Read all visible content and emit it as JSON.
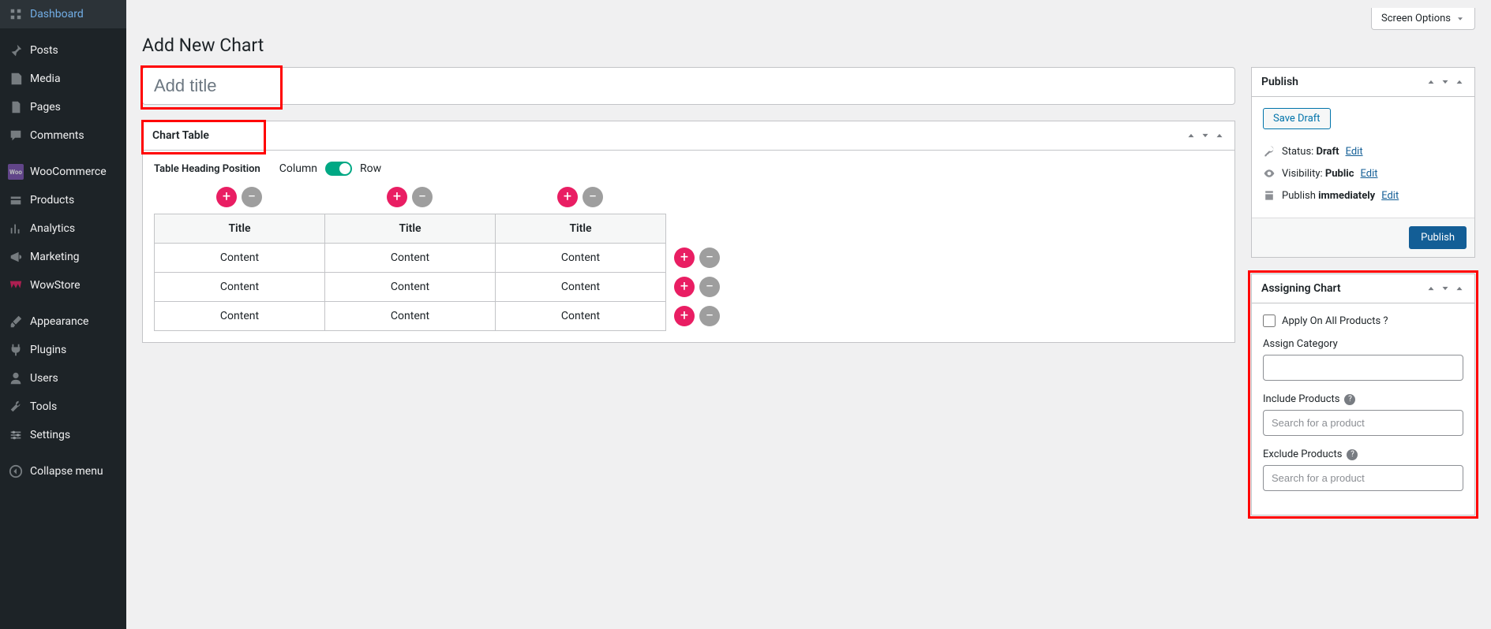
{
  "screen_options": "Screen Options",
  "page_title": "Add New Chart",
  "title_placeholder": "Add title",
  "sidebar": {
    "dashboard": "Dashboard",
    "posts": "Posts",
    "media": "Media",
    "pages": "Pages",
    "comments": "Comments",
    "woocommerce": "WooCommerce",
    "products": "Products",
    "analytics": "Analytics",
    "marketing": "Marketing",
    "wowstore": "WowStore",
    "appearance": "Appearance",
    "plugins": "Plugins",
    "users": "Users",
    "tools": "Tools",
    "settings": "Settings",
    "collapse": "Collapse menu"
  },
  "chart_table": {
    "title": "Chart Table",
    "heading_position_label": "Table Heading Position",
    "col_label": "Column",
    "row_label": "Row",
    "headers": [
      "Title",
      "Title",
      "Title"
    ],
    "rows": [
      [
        "Content",
        "Content",
        "Content"
      ],
      [
        "Content",
        "Content",
        "Content"
      ],
      [
        "Content",
        "Content",
        "Content"
      ]
    ]
  },
  "publish": {
    "title": "Publish",
    "save_draft": "Save Draft",
    "status_label": "Status: ",
    "status_value": "Draft",
    "visibility_label": "Visibility: ",
    "visibility_value": "Public",
    "schedule_label": "Publish ",
    "schedule_value": "immediately",
    "edit": "Edit",
    "publish_btn": "Publish"
  },
  "assigning": {
    "title": "Assigning Chart",
    "apply_all": "Apply On All Products ?",
    "assign_cat": "Assign Category",
    "include": "Include Products",
    "exclude": "Exclude Products",
    "search_placeholder": "Search for a product"
  }
}
